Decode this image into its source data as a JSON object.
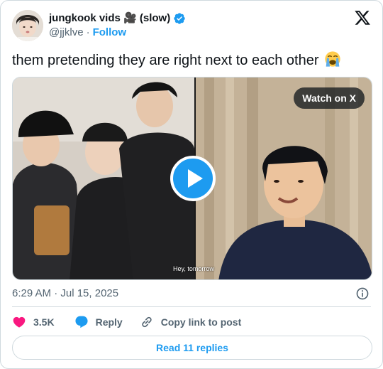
{
  "author": {
    "display_name": "jungkook vids 🎥 (slow)",
    "handle": "@jjklve",
    "separator": "·",
    "follow_label": "Follow",
    "verified": true
  },
  "tweet": {
    "text": "them pretending they are right next to each other",
    "emoji": "loudly-crying-face-icon",
    "timestamp": "6:29 AM · Jul 15, 2025"
  },
  "media": {
    "type": "video",
    "watch_label": "Watch on X",
    "subtitle": "Hey, tomorrow"
  },
  "engagement": {
    "likes": "3.5K",
    "reply_label": "Reply",
    "copy_link_label": "Copy link to post"
  },
  "footer": {
    "read_replies_label": "Read 11 replies"
  },
  "colors": {
    "accent": "#1d9bf0",
    "like": "#f91880",
    "text_primary": "#0f1419",
    "text_secondary": "#536471",
    "border": "#cfd9de"
  }
}
